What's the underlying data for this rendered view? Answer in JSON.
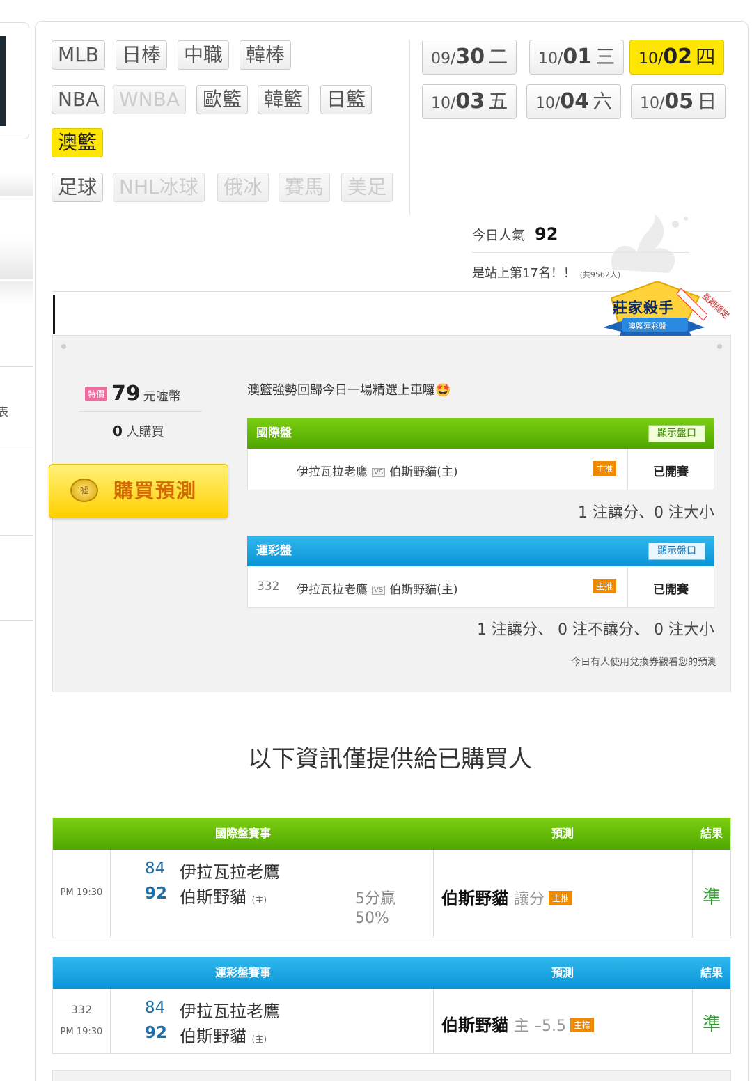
{
  "sports": {
    "row1": [
      "MLB",
      "日棒",
      "中職",
      "韓棒"
    ],
    "row2": [
      "NBA",
      "WNBA",
      "歐籃",
      "韓籃",
      "日籃"
    ],
    "row3": [
      "澳籃"
    ],
    "row4": [
      "足球",
      "NHL冰球",
      "俄冰",
      "賽馬",
      "美足"
    ]
  },
  "dates": [
    {
      "md": "09/",
      "dd": "30",
      "wd": "二"
    },
    {
      "md": "10/",
      "dd": "01",
      "wd": "三"
    },
    {
      "md": "10/",
      "dd": "02",
      "wd": "四"
    },
    {
      "md": "10/",
      "dd": "03",
      "wd": "五"
    },
    {
      "md": "10/",
      "dd": "04",
      "wd": "六"
    },
    {
      "md": "10/",
      "dd": "05",
      "wd": "日"
    }
  ],
  "popularity": {
    "label": "今日人氣",
    "value": "92",
    "rank": "是站上第17名！！",
    "total": "(共9562人)"
  },
  "badge": {
    "title": "莊家殺手",
    "sub": "澳籃運彩盤",
    "ribbon": "長期穩定"
  },
  "offer": {
    "tag": "特價",
    "price": "79",
    "unit": "元噓幣",
    "buyers_num": "0",
    "buyers_label": "人購買",
    "buy_button": "購買預測",
    "coin_text": "噓",
    "description": "澳籃強勢回歸今日一場精選上車囉🤩"
  },
  "intl_panel": {
    "title": "國際盤",
    "show_label": "顯示盤口",
    "code": "",
    "away": "伊拉瓦拉老鷹",
    "home": "伯斯野貓(主)",
    "vs": "VS",
    "push": "主推",
    "status": "已開賽",
    "count": "1 注讓分、0 注大小"
  },
  "lottery_panel": {
    "title": "運彩盤",
    "show_label": "顯示盤口",
    "code": "332",
    "away": "伊拉瓦拉老鷹",
    "home": "伯斯野貓(主)",
    "vs": "VS",
    "push": "主推",
    "status": "已開賽",
    "count": "1 注讓分、 0 注不讓分、 0 注大小"
  },
  "usage_note": "今日有人使用兌換券觀看您的預測",
  "buyer_heading": "以下資訊僅提供給已購買人",
  "intl_result": {
    "h_match": "國際盤賽事",
    "h_pred": "預測",
    "h_result": "結果",
    "code": "",
    "time": "PM 19:30",
    "away_score": "84",
    "away": "伊拉瓦拉老鷹",
    "home_score": "92",
    "home": "伯斯野貓",
    "home_tag": "(主)",
    "margin": "5分贏",
    "margin_pct": "50%",
    "pred_team": "伯斯野貓",
    "pred_type": "讓分",
    "push": "主推",
    "result": "準"
  },
  "lottery_result": {
    "h_match": "運彩盤賽事",
    "h_pred": "預測",
    "h_result": "結果",
    "code": "332",
    "time": "PM 19:30",
    "away_score": "84",
    "away": "伊拉瓦拉老鷹",
    "home_score": "92",
    "home": "伯斯野貓",
    "home_tag": "(主)",
    "pred_team": "伯斯野貓",
    "pred_type": "主 –5.5",
    "push": "主推",
    "result": "準"
  },
  "left_partial_char": "表",
  "colors": {
    "green": "#4fa600",
    "blue": "#0a94d6",
    "yellow": "#ffe600",
    "accent": "#f08a00",
    "win": "#2e9a2e"
  }
}
